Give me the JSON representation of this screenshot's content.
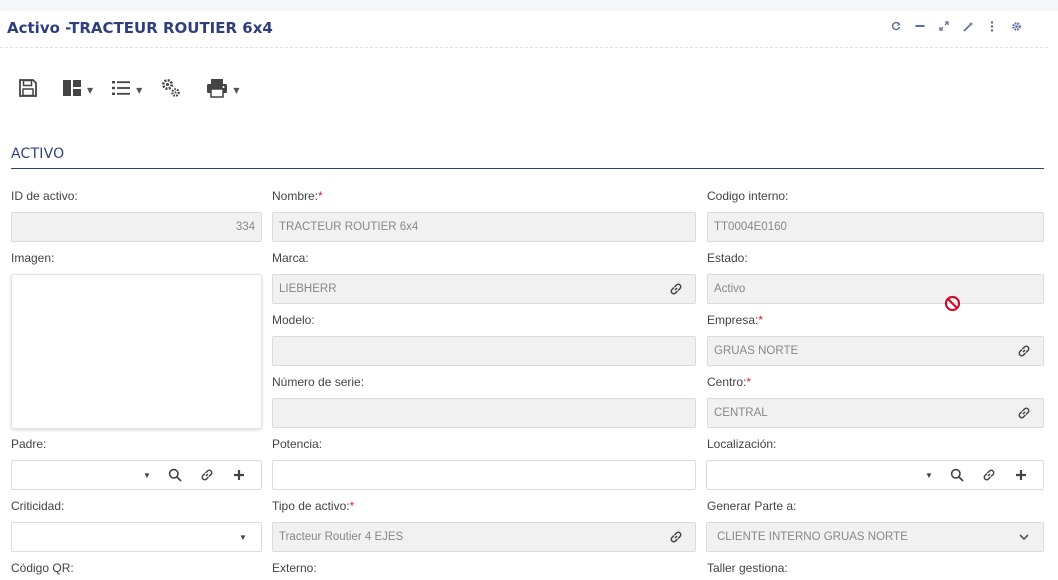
{
  "window": {
    "title": "Activo -TRACTEUR ROUTIER 6x4",
    "tools": [
      "refresh-icon",
      "minimize-icon",
      "expand-icon",
      "magic-wand-icon",
      "more-vertical-icon",
      "settings-icon"
    ]
  },
  "toolbar": {
    "items": [
      "save-icon",
      "layout-icon",
      "list-icon",
      "cogs-icon",
      "print-icon"
    ]
  },
  "section": {
    "title": "ACTIVO"
  },
  "fields": {
    "id_activo": {
      "label": "ID de activo:",
      "value": "334"
    },
    "nombre": {
      "label": "Nombre:",
      "required": "*",
      "value": "TRACTEUR ROUTIER 6x4"
    },
    "codigo_interno": {
      "label": "Codigo interno:",
      "value": "TT0004E0160"
    },
    "imagen": {
      "label": "Imagen:"
    },
    "marca": {
      "label": "Marca:",
      "value": "LIEBHERR"
    },
    "estado": {
      "label": "Estado:",
      "value": "Activo"
    },
    "modelo": {
      "label": "Modelo:",
      "value": ""
    },
    "empresa": {
      "label": "Empresa:",
      "required": "*",
      "value": "GRUAS NORTE"
    },
    "numero_serie": {
      "label": "Número de serie:",
      "value": ""
    },
    "centro": {
      "label": "Centro:",
      "required": "*",
      "value": "CENTRAL"
    },
    "padre": {
      "label": "Padre:",
      "value": ""
    },
    "potencia": {
      "label": "Potencia:",
      "value": ""
    },
    "localizacion": {
      "label": "Localización:",
      "value": ""
    },
    "criticidad": {
      "label": "Criticidad:",
      "value": ""
    },
    "tipo_activo": {
      "label": "Tipo de activo:",
      "required": "*",
      "value": "Tracteur Routier 4 EJES"
    },
    "generar_parte": {
      "label": "Generar Parte a:",
      "value": "CLIENTE INTERNO GRUAS NORTE"
    },
    "codigo_qr": {
      "label": "Código QR:"
    },
    "externo": {
      "label": "Externo:"
    },
    "taller_gestiona": {
      "label": "Taller gestiona:"
    }
  },
  "colors": {
    "accent": "#2f3f7b",
    "required": "#d9232d",
    "field_disabled_bg": "#f1f1f1",
    "blocked": "#c8102e"
  }
}
